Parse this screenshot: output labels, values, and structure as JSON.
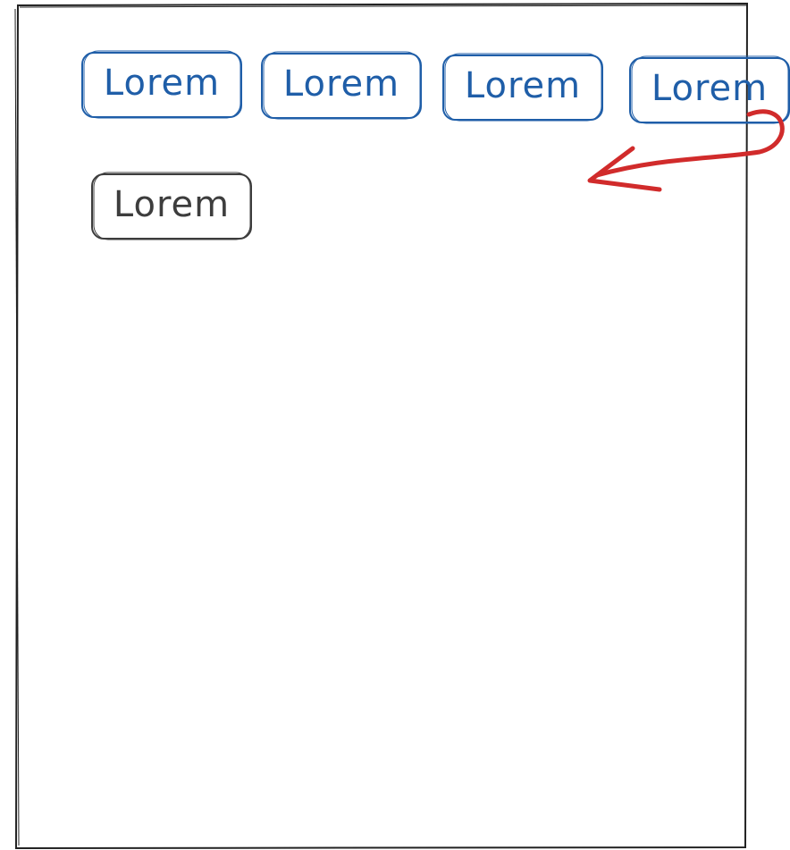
{
  "colors": {
    "tag_primary": "#1f5ea8",
    "tag_secondary": "#3d3d3d",
    "arrow": "#d12b2b",
    "frame": "#222222"
  },
  "tags": [
    {
      "label": "Lorem",
      "style": "blue"
    },
    {
      "label": "Lorem",
      "style": "blue"
    },
    {
      "label": "Lorem",
      "style": "blue"
    },
    {
      "label": "Lorem",
      "style": "blue"
    },
    {
      "label": "Lorem",
      "style": "gray"
    }
  ],
  "arrow": {
    "meaning": "wrap-overflow-to-next-line",
    "icon": "curved-arrow-left-icon"
  }
}
